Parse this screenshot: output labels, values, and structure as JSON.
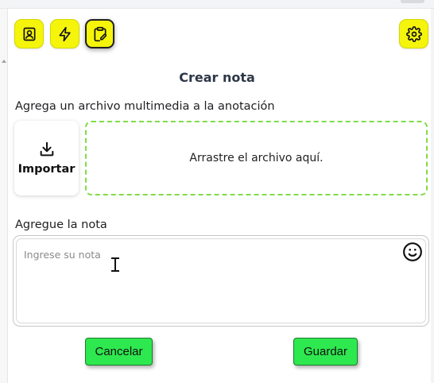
{
  "toolbar": {
    "buttons": [
      {
        "icon": "contact-book-icon",
        "active": false
      },
      {
        "icon": "lightning-icon",
        "active": false
      },
      {
        "icon": "clipboard-edit-icon",
        "active": true
      }
    ],
    "settings_icon": "gear-icon",
    "accent_color": "#f5f50c"
  },
  "form": {
    "title": "Crear nota",
    "media_label": "Agrega un archivo multimedia a la anotación",
    "import_label": "Importar",
    "dropzone_text": "Arrastre el archivo aquí.",
    "dropzone_border_color": "#7fdc45",
    "note_label": "Agregue la nota",
    "note_placeholder": "Ingrese su nota",
    "note_value": ""
  },
  "actions": {
    "cancel_label": "Cancelar",
    "save_label": "Guardar",
    "button_color": "#2ee84f"
  }
}
